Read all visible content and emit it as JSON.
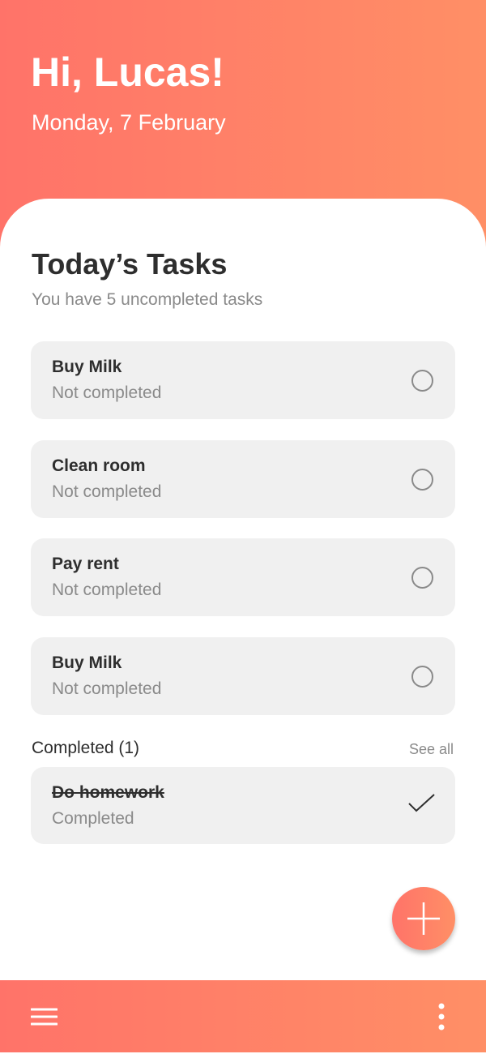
{
  "header": {
    "greeting": "Hi, Lucas!",
    "date": "Monday, 7 February"
  },
  "main": {
    "title": "Today’s Tasks",
    "subtitle": "You have 5 uncompleted tasks",
    "tasks": [
      {
        "title": "Buy Milk",
        "status": "Not completed"
      },
      {
        "title": "Clean room",
        "status": "Not completed"
      },
      {
        "title": "Pay rent",
        "status": "Not completed"
      },
      {
        "title": "Buy Milk",
        "status": "Not completed"
      }
    ],
    "completed_header": "Completed (1)",
    "see_all": "See all",
    "completed": [
      {
        "title": "Do homework",
        "status": "Completed"
      }
    ]
  },
  "colors": {
    "gradient_start": "#ff7369",
    "gradient_end": "#ff8f66",
    "card": "#f0f0f0"
  },
  "icons": {
    "fab": "plus-icon",
    "menu": "hamburger-icon",
    "more": "more-vert-icon",
    "done": "check-icon",
    "todo": "circle-icon"
  }
}
